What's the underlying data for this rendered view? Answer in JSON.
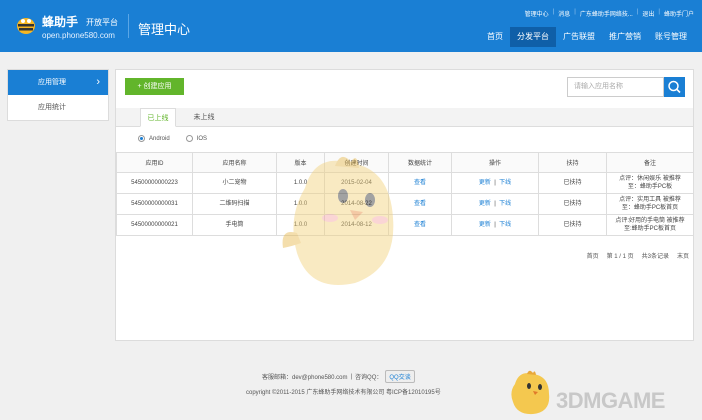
{
  "header": {
    "logo_name": "蜂助手",
    "logo_sub": "开放平台",
    "logo_url": "open.phone580.com",
    "center_title": "管理中心",
    "top_links": [
      "管理中心",
      "消息",
      "广东蜂助手网络技...",
      "退出",
      "蜂助手门户"
    ],
    "nav": [
      "首页",
      "分发平台",
      "广告联盟",
      "推广营销",
      "账号管理"
    ],
    "active_nav": "分发平台"
  },
  "sidebar": {
    "items": [
      {
        "label": "应用管理",
        "active": true
      },
      {
        "label": "应用统计",
        "active": false
      }
    ]
  },
  "main": {
    "create_button": "+ 创建应用",
    "search_placeholder": "请输入应用名称",
    "tabs": [
      "已上线",
      "未上线"
    ],
    "platforms": [
      "Android",
      "IOS"
    ],
    "selected_platform": "Android",
    "table": {
      "columns": [
        "应用ID",
        "应用名称",
        "版本",
        "创建时间",
        "数据统计",
        "操作",
        "扶持",
        "备注"
      ],
      "rows": [
        {
          "id": "54500000000223",
          "name": "小二宠物",
          "version": "1.0.0",
          "created": "2015-02-04",
          "stats": "查看",
          "op1": "更新",
          "op2": "下线",
          "support": "已扶持",
          "note1": "点评：休闲娱乐 被推荐",
          "note2": "至：蜂助手PC板"
        },
        {
          "id": "54500000000031",
          "name": "二维码扫描",
          "version": "1.0.0",
          "created": "2014-08-22",
          "stats": "查看",
          "op1": "更新",
          "op2": "下线",
          "support": "已扶持",
          "note1": "点评：实用工具 被推荐",
          "note2": "至：蜂助手PC板首页"
        },
        {
          "id": "54500000000021",
          "name": "手电筒",
          "version": "1.0.0",
          "created": "2014-08-12",
          "stats": "查看",
          "op1": "更新",
          "op2": "下线",
          "support": "已扶持",
          "note1": "点评:好用的手电筒 被推荐",
          "note2": "至:蜂助手PC板首页"
        }
      ]
    },
    "pager": [
      "首页",
      "第 1 / 1 页",
      "共3条记录",
      "末页"
    ]
  },
  "footer": {
    "email": "客服邮箱：dev@phone580.com",
    "qq_label": "咨询QQ：",
    "qq_button": "QQ交谈",
    "copyright": "copyright ©2011-2015  广东蜂助手网络技术有限公司  粤ICP备12010195号"
  },
  "watermark": "3DMGAME",
  "colors": {
    "brand": "#1a7fd4",
    "nav_active": "#0f5fa8",
    "green": "#62b52b"
  },
  "icons": [
    "bee-logo-icon",
    "search-icon",
    "chevron-right-icon",
    "mascot-bird-icon"
  ]
}
